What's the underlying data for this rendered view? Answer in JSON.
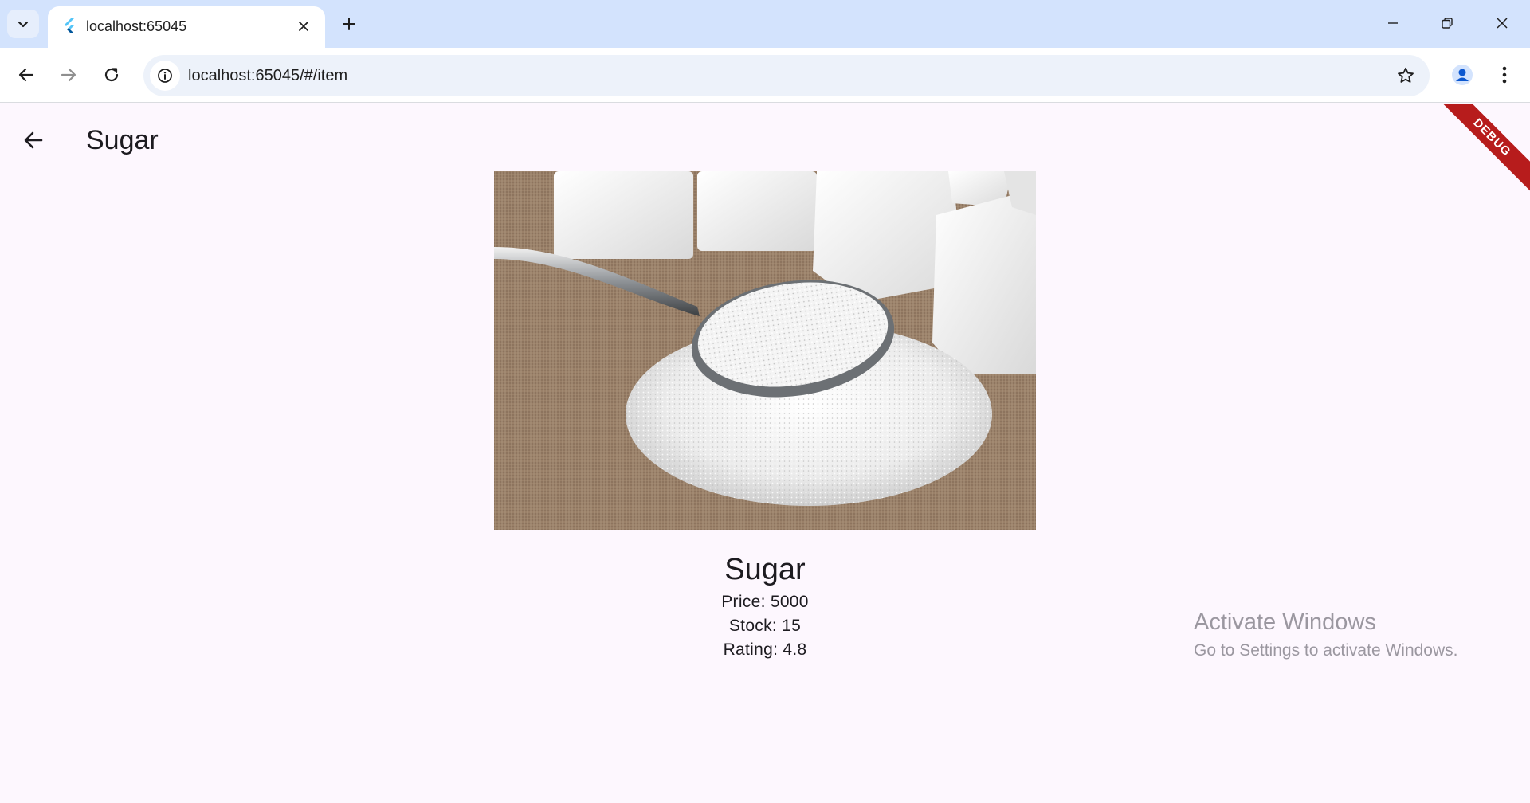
{
  "browser": {
    "tab_title": "localhost:65045",
    "url": "localhost:65045/#/item"
  },
  "app": {
    "appbar_title": "Sugar",
    "debug_label": "DEBUG"
  },
  "product": {
    "name": "Sugar",
    "price_text": "Price: 5000",
    "stock_text": "Stock: 15",
    "rating_text": "Rating: 4.8",
    "image_alt": "Sugar"
  },
  "os_watermark": {
    "title": "Activate Windows",
    "subtitle": "Go to Settings to activate Windows."
  },
  "colors": {
    "tabstrip_bg": "#d3e3fd",
    "omnibox_bg": "#edf2fa",
    "app_bg": "#fdf7fe",
    "debug_banner": "#b71c1c",
    "profile_accent": "#0b57d0"
  },
  "icons": {
    "tab_search": "chevron-down-icon",
    "favicon": "flutter-logo-icon",
    "tab_close": "close-icon",
    "new_tab": "plus-icon",
    "minimize": "minimize-icon",
    "restore": "restore-icon",
    "close_window": "close-icon",
    "back": "arrow-left-icon",
    "forward": "arrow-right-icon",
    "reload": "reload-icon",
    "site_info": "info-icon",
    "bookmark": "star-icon",
    "profile": "person-icon",
    "menu": "more-vert-icon",
    "appbar_back": "arrow-left-icon"
  }
}
